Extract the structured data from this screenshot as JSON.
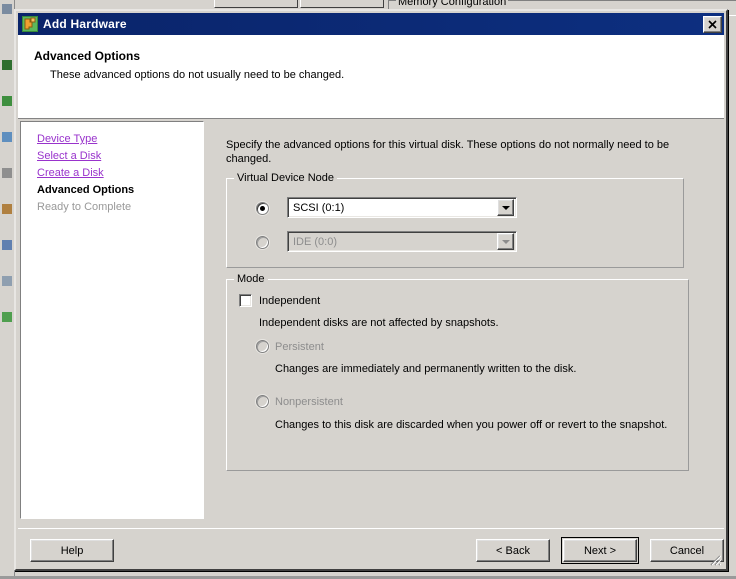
{
  "background": {
    "group_label": "Memory Configuration"
  },
  "window": {
    "title": "Add Hardware",
    "icon": "add-hardware-icon",
    "close_label": "✕"
  },
  "header": {
    "title": "Advanced Options",
    "subtitle": "These advanced options do not usually need to be changed."
  },
  "sidebar": {
    "items": [
      {
        "label": "Device Type",
        "state": "link"
      },
      {
        "label": "Select a Disk",
        "state": "link"
      },
      {
        "label": "Create a Disk",
        "state": "link"
      },
      {
        "label": "Advanced Options",
        "state": "current"
      },
      {
        "label": "Ready to Complete",
        "state": "future"
      }
    ]
  },
  "content": {
    "intro": "Specify the advanced options for this virtual disk. These options do not normally need to be changed.",
    "virtual_device_node": {
      "legend": "Virtual Device Node",
      "options": [
        {
          "value": "SCSI (0:1)",
          "selected": true,
          "enabled": true
        },
        {
          "value": "IDE (0:0)",
          "selected": false,
          "enabled": false
        }
      ]
    },
    "mode": {
      "legend": "Mode",
      "independent": {
        "label": "Independent",
        "checked": false,
        "description": "Independent disks are not affected by snapshots."
      },
      "radios": [
        {
          "label": "Persistent",
          "selected": false,
          "enabled": false,
          "description": "Changes are immediately and permanently written to the disk."
        },
        {
          "label": "Nonpersistent",
          "selected": false,
          "enabled": false,
          "description": "Changes to this disk are discarded when you power off or revert to the snapshot."
        }
      ]
    }
  },
  "footer": {
    "help": "Help",
    "back": "< Back",
    "next": "Next >",
    "cancel": "Cancel"
  },
  "colors": {
    "dialog_face": "#d6d3ce",
    "titlebar": "#0a246a",
    "link": "#9933cc",
    "disabled_text": "#8d8d8d",
    "panel_white": "#ffffff"
  }
}
